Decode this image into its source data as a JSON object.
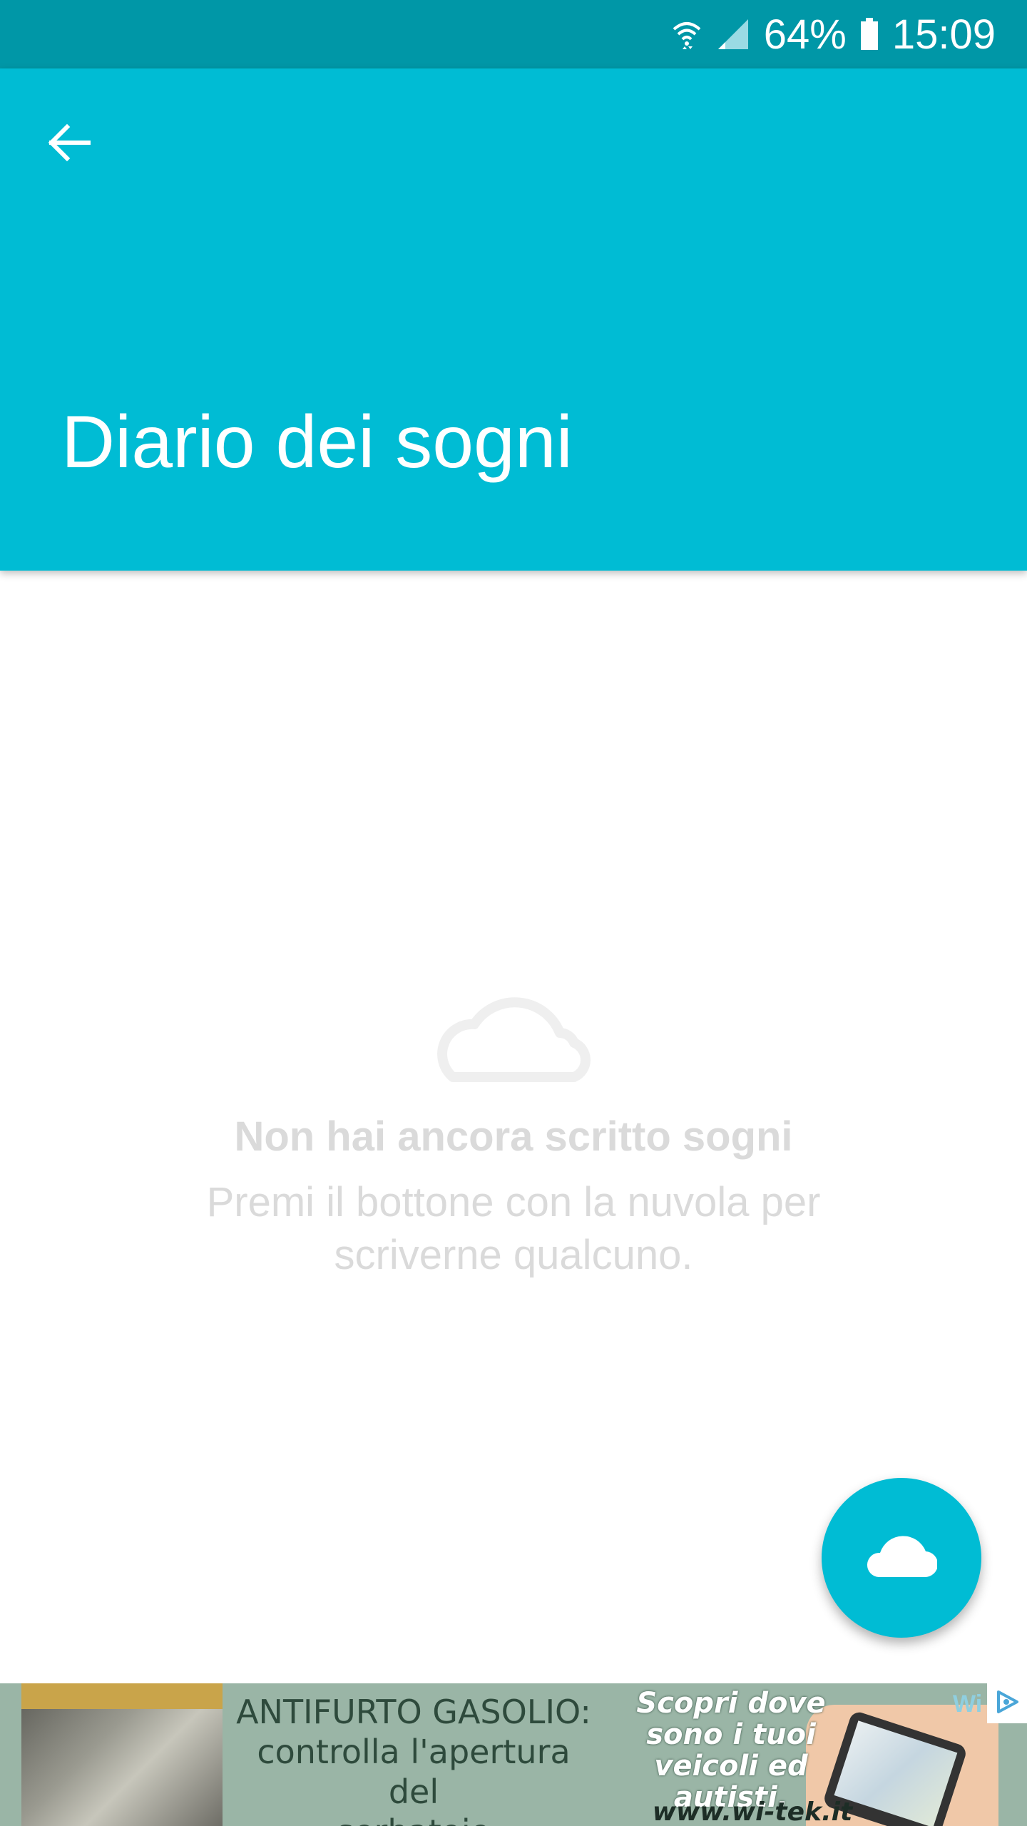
{
  "status_bar": {
    "battery_percent": "64%",
    "time": "15:09",
    "icons": [
      "wifi-icon",
      "signal-icon",
      "battery-icon"
    ]
  },
  "app_bar": {
    "back_icon": "arrow-back-icon",
    "title": "Diario dei sogni"
  },
  "empty_state": {
    "icon": "cloud-outline-icon",
    "title": "Non hai ancora scritto sogni",
    "subtitle": "Premi il bottone con la nuvola per scriverne qualcuno."
  },
  "fab": {
    "icon": "cloud-icon"
  },
  "ad": {
    "headline_line1": "ANTIFURTO GASOLIO:",
    "headline_line2": "controlla l'apertura del",
    "headline_line3": "serbatoio",
    "right_text": "Scopri dove sono i tuoi veicoli ed autisti.",
    "url": "www.wi-tek.it",
    "brand": "Wi",
    "choices_icon": "ad-choices-icon"
  },
  "colors": {
    "primary": "#00bcd4",
    "primary_dark": "#0097a7",
    "empty_text": "#dadada",
    "ad_background": "#9ab5a6"
  }
}
